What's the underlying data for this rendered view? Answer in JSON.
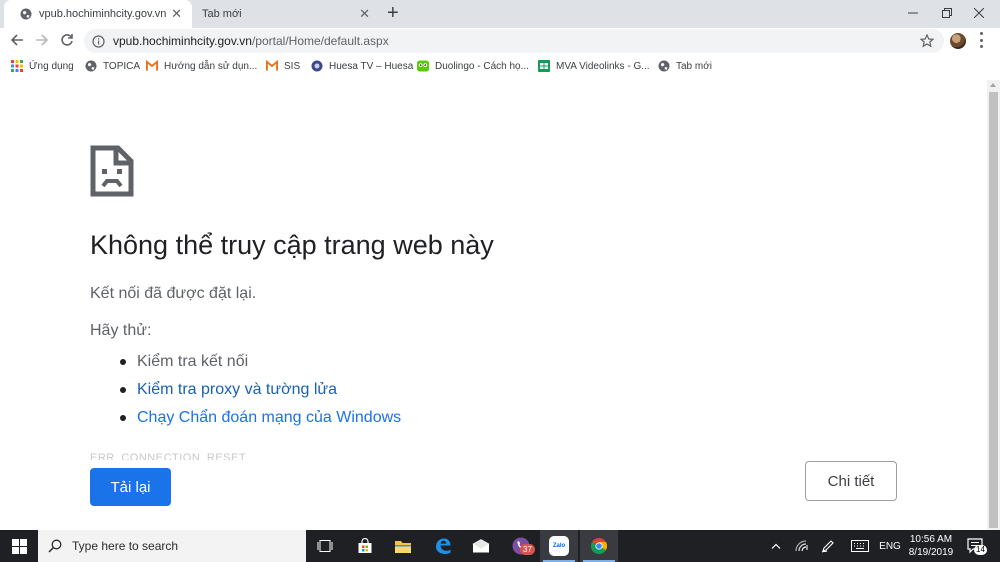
{
  "tabs": [
    {
      "title": "vpub.hochiminhcity.gov.vn",
      "active": true
    },
    {
      "title": "Tab mới",
      "active": false
    }
  ],
  "address": {
    "host": "vpub.hochiminhcity.gov.vn",
    "path": "/portal/Home/default.aspx"
  },
  "bookmarks": [
    {
      "label": "Ứng dụng",
      "icon": "apps-grid-icon"
    },
    {
      "label": "TOPICA",
      "icon": "globe-icon"
    },
    {
      "label": "Hướng dẫn sử dụn...",
      "icon": "gmail-icon"
    },
    {
      "label": "SIS",
      "icon": "gmail-icon"
    },
    {
      "label": "Huesa TV – Huesa",
      "icon": "huesa-icon"
    },
    {
      "label": "Duolingo - Cách họ...",
      "icon": "duolingo-icon"
    },
    {
      "label": "MVA Videolinks - G...",
      "icon": "sheets-icon"
    },
    {
      "label": "Tab mới",
      "icon": "globe-icon"
    }
  ],
  "error": {
    "title": "Không thể truy cập trang web này",
    "subtitle": "Kết nối đã được đặt lại.",
    "try_label": "Hãy thử:",
    "suggestions": [
      "Kiểm tra kết nối",
      "Kiểm tra proxy và tường lửa",
      "Chạy Chẩn đoán mạng của Windows"
    ],
    "code": "ERR_CONNECTION_RESET",
    "reload_label": "Tải lại",
    "details_label": "Chi tiết"
  },
  "taskbar": {
    "search_placeholder": "Type here to search",
    "viber_badge": "37",
    "zalo_label": "Zalo",
    "language": "ENG",
    "time": "10:56 AM",
    "date": "8/19/2019",
    "notification_count": "14"
  },
  "colors": {
    "accent": "#1a73e8",
    "taskbar": "#1f2024",
    "tabstrip": "#dee1e6"
  }
}
